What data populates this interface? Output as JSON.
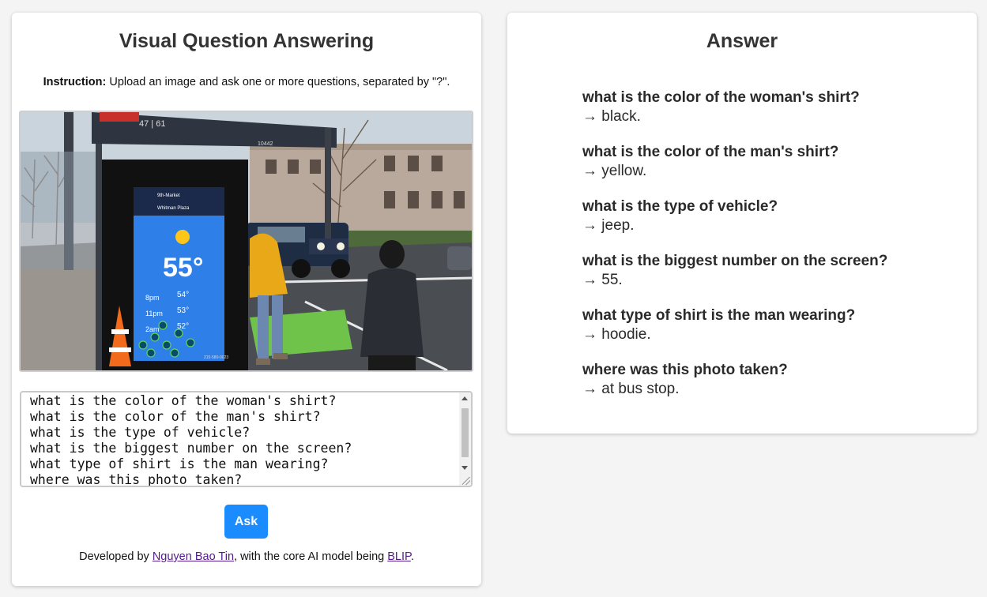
{
  "left_panel": {
    "title": "Visual Question Answering",
    "instruction_label": "Instruction:",
    "instruction_text": " Upload an image and ask one or more questions, separated by \"?\".",
    "question_input_value": "what is the color of the woman's shirt?\nwhat is the color of the man's shirt?\nwhat is the type of vehicle?\nwhat is the biggest number on the screen?\nwhat type of shirt is the man wearing?\nwhere was this photo taken?",
    "ask_label": "Ask",
    "footer": {
      "prefix": "Developed by ",
      "author_link": "Nguyen Bao Tin",
      "middle": ", with the core AI model being ",
      "model_link": "BLIP",
      "suffix": "."
    }
  },
  "image": {
    "screen_route_1": "9th-Market",
    "screen_route_2": "Whitman Plaza",
    "screen_temp": "55°",
    "forecast": [
      {
        "time": "8pm",
        "temp": "54°"
      },
      {
        "time": "11pm",
        "temp": "53°"
      },
      {
        "time": "2am",
        "temp": "52°"
      }
    ],
    "shelter_route": "47 | 61",
    "shelter_stop": "10442",
    "screen_phone": "215-580-0023"
  },
  "right_panel": {
    "title": "Answer",
    "answers": [
      {
        "question": "what is the color of the woman's shirt?",
        "answer": "→ black."
      },
      {
        "question": "what is the color of the man's shirt?",
        "answer": "→ yellow."
      },
      {
        "question": "what is the type of vehicle?",
        "answer": "→ jeep."
      },
      {
        "question": "what is the biggest number on the screen?",
        "answer": "→ 55."
      },
      {
        "question": "what type of shirt is the man wearing?",
        "answer": "→ hoodie."
      },
      {
        "question": "where was this photo taken?",
        "answer": "→ at bus stop."
      }
    ]
  },
  "colors": {
    "ask_button": "#1a8cff",
    "link_visited": "#551a8b",
    "screen_blue": "#2f7fe8"
  }
}
